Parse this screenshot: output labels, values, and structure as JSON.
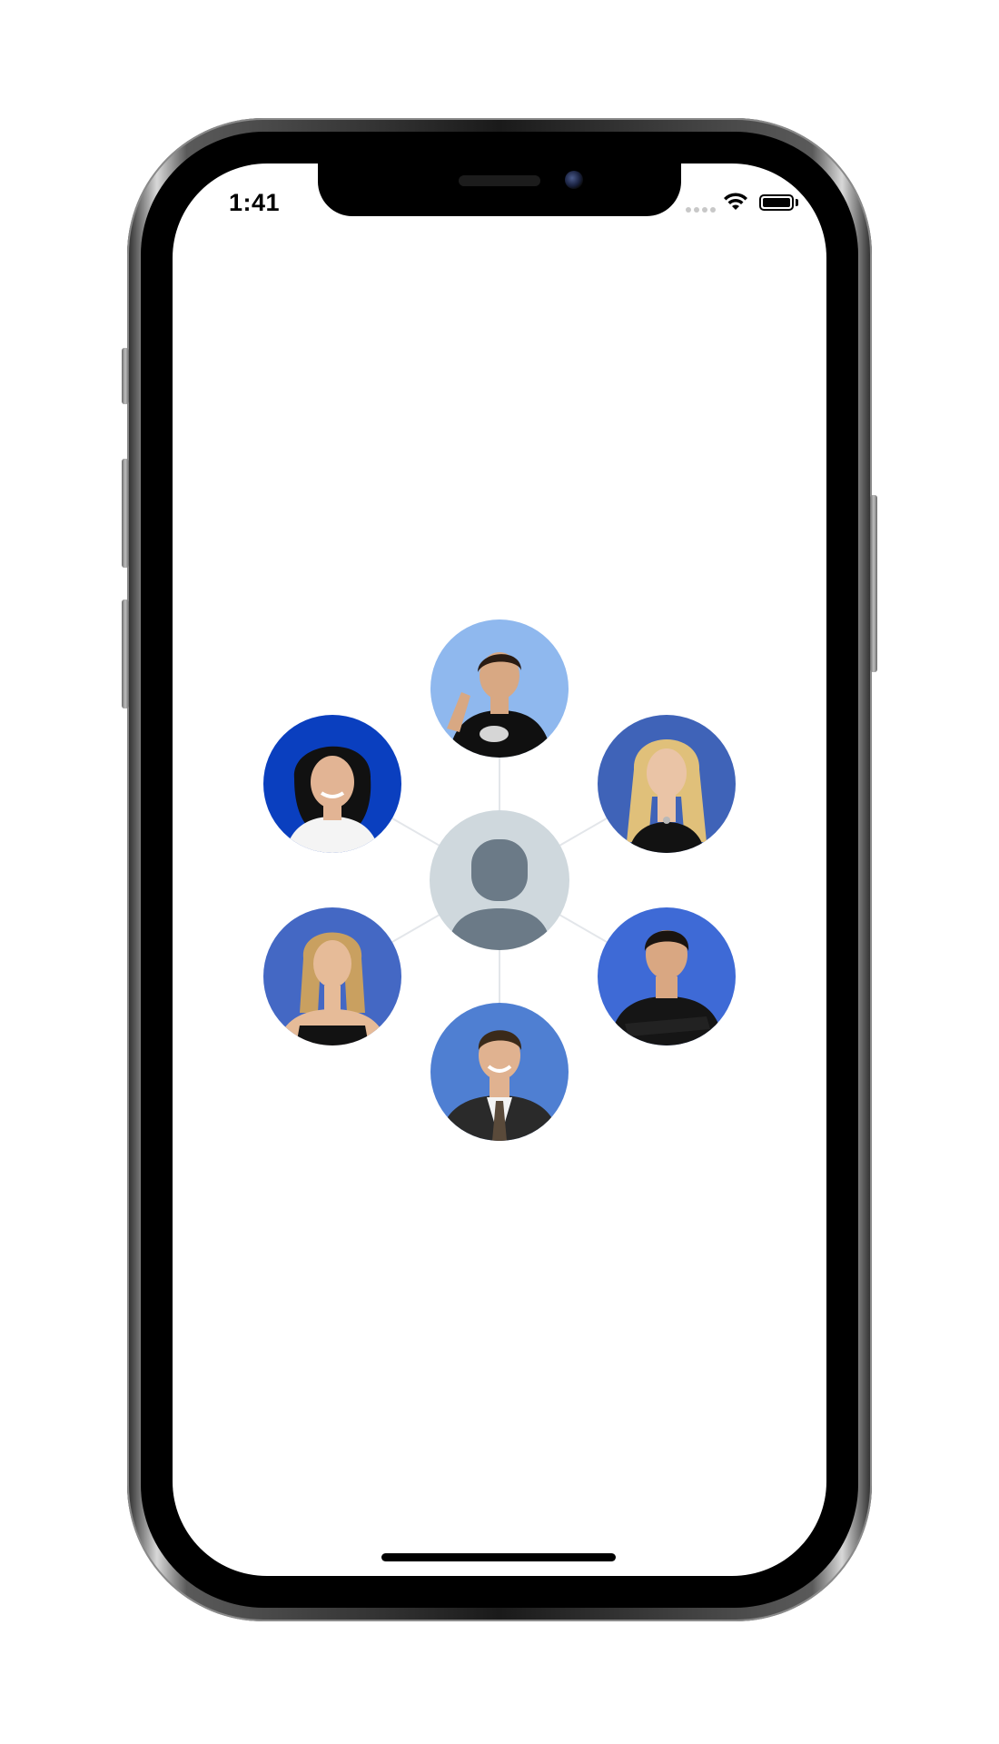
{
  "status_bar": {
    "time": "1:41"
  },
  "graph": {
    "center": {
      "icon": "default-avatar-icon"
    },
    "friends": [
      {
        "slot": "top",
        "icon": "person-photo-icon",
        "bg": "#8fb8ee",
        "shirt": "#101010",
        "hair": "#2a1b12"
      },
      {
        "slot": "top-left",
        "icon": "person-photo-icon",
        "bg": "#0a3fbf",
        "shirt": "#f4f4f4",
        "hair": "#111111"
      },
      {
        "slot": "top-right",
        "icon": "person-photo-icon",
        "bg": "#3f63b8",
        "shirt": "#121212",
        "hair": "#e0c07a"
      },
      {
        "slot": "bottom-left",
        "icon": "person-photo-icon",
        "bg": "#4468c4",
        "shirt": "#121212",
        "hair": "#c9a060"
      },
      {
        "slot": "bottom-right",
        "icon": "person-photo-icon",
        "bg": "#3e6ad6",
        "shirt": "#151515",
        "hair": "#1a1410"
      },
      {
        "slot": "bottom",
        "icon": "person-photo-icon",
        "bg": "#4f7fd2",
        "shirt": "#2a2a2a",
        "hair": "#3a2a1a"
      }
    ]
  },
  "colors": {
    "avatar_bg": "#cfd8dd",
    "avatar_fg": "#6b7a87",
    "edge": "#e3e6ea"
  }
}
